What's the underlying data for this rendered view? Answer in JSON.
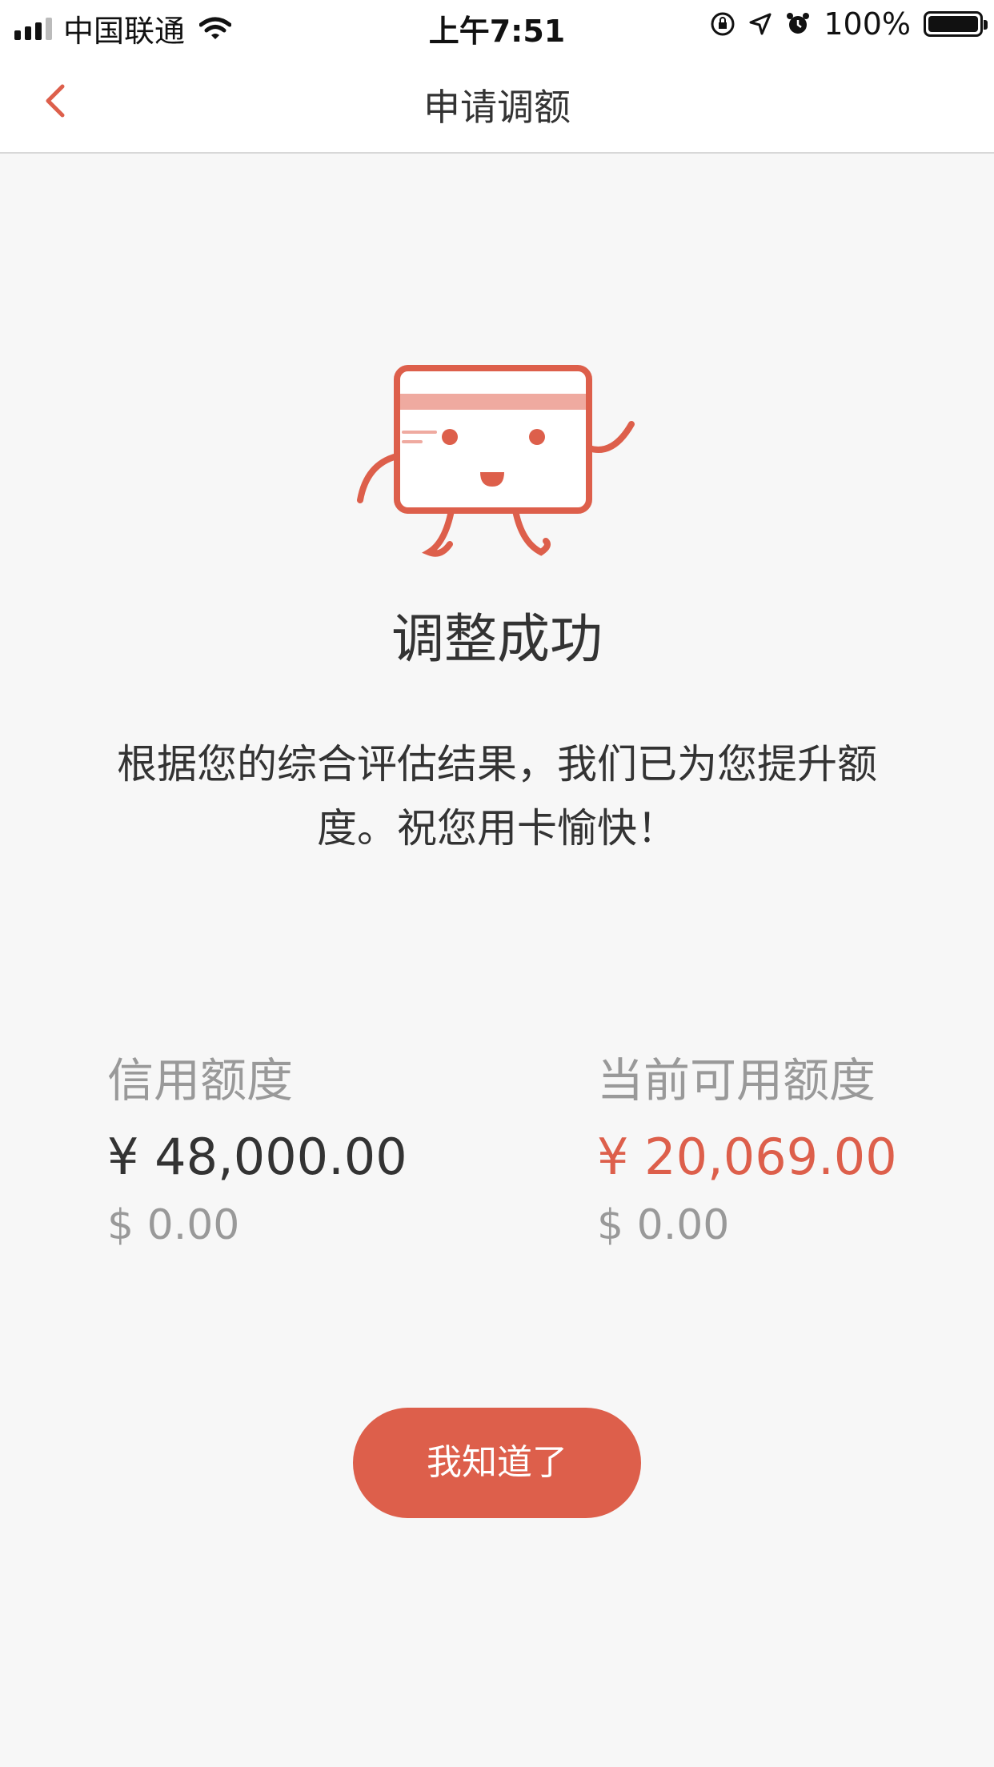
{
  "status_bar": {
    "carrier": "中国联通",
    "time": "上午7:51",
    "battery": "100%",
    "signal_icon": "signal-icon",
    "wifi_icon": "wifi-icon"
  },
  "nav": {
    "title": "申请调额",
    "back_icon": "chevron-left-icon"
  },
  "result": {
    "title": "调整成功",
    "message": "根据您的综合评估结果，我们已为您提升额度。祝您用卡愉快！"
  },
  "limits": {
    "credit": {
      "label": "信用额度",
      "cny": "¥ 48,000.00",
      "usd": "$ 0.00"
    },
    "available": {
      "label": "当前可用额度",
      "cny": "¥ 20,069.00",
      "usd": "$ 0.00"
    }
  },
  "actions": {
    "ok_label": "我知道了"
  },
  "colors": {
    "accent": "#dd5f4b",
    "background": "#f7f7f7"
  }
}
